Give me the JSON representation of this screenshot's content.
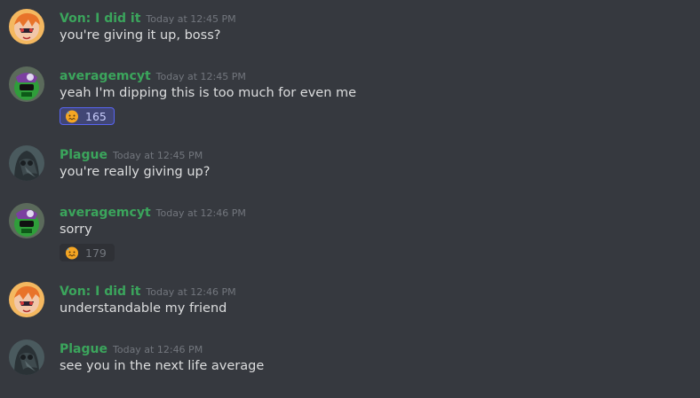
{
  "messages": [
    {
      "username": "Von: I did it",
      "timestamp": "Today at 12:45 PM",
      "text": "you're giving it up, boss?",
      "avatar": "von-avatar"
    },
    {
      "username": "averagemcyt",
      "timestamp": "Today at 12:45 PM",
      "text": "yeah I'm dipping this is too much for even me",
      "avatar": "averagemcyt-avatar",
      "reaction": {
        "emoji": "sweating-face-icon",
        "count": "165",
        "reacted": true
      }
    },
    {
      "username": "Plague",
      "timestamp": "Today at 12:45 PM",
      "text": "you're really giving up?",
      "avatar": "plague-avatar"
    },
    {
      "username": "averagemcyt",
      "timestamp": "Today at 12:46 PM",
      "text": "sorry",
      "avatar": "averagemcyt-avatar",
      "reaction": {
        "emoji": "sweating-face-icon",
        "count": "179",
        "reacted": false
      }
    },
    {
      "username": "Von: I did it",
      "timestamp": "Today at 12:46 PM",
      "text": "understandable my friend",
      "avatar": "von-avatar"
    },
    {
      "username": "Plague",
      "timestamp": "Today at 12:46 PM",
      "text": "see you in the next life average",
      "avatar": "plague-avatar"
    }
  ],
  "colors": {
    "background": "#36393f",
    "username": "#3ba55c",
    "timestamp": "#72767d",
    "message_text": "#dcddde",
    "reaction_active_bg": "#414675",
    "reaction_active_border": "#5865f2",
    "reaction_inactive_bg": "#2f3136"
  }
}
